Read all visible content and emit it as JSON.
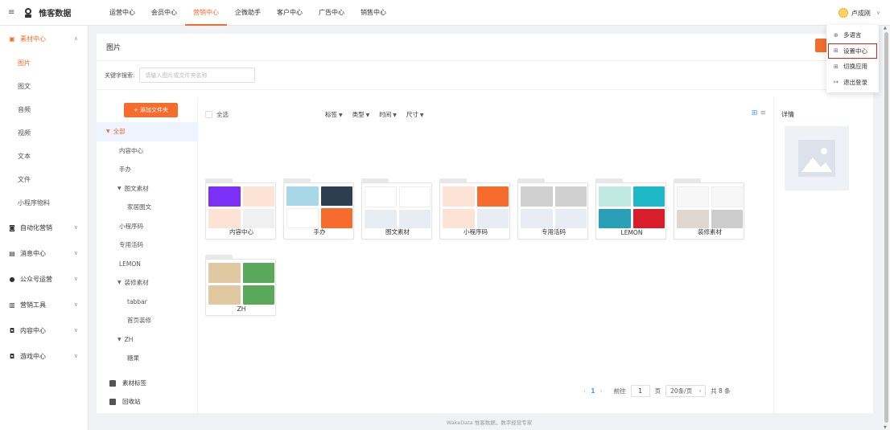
{
  "topbar": {
    "brand": "惟客数据",
    "nav": [
      "运营中心",
      "会员中心",
      "营销中心",
      "企微助手",
      "客户中心",
      "广告中心",
      "销售中心"
    ],
    "active_nav_index": 2,
    "user_name": "卢成刚"
  },
  "sidebar": {
    "items": [
      {
        "label": "素材中心",
        "icon": "image-icon",
        "open": true,
        "children": [
          "图片",
          "图文",
          "音频",
          "视频",
          "文本",
          "文件",
          "小程序物料"
        ]
      },
      {
        "label": "自动化营销",
        "icon": "robot-icon"
      },
      {
        "label": "消息中心",
        "icon": "message-icon"
      },
      {
        "label": "公众号运营",
        "icon": "chat-icon"
      },
      {
        "label": "营销工具",
        "icon": "bar-chart-icon"
      },
      {
        "label": "内容中心",
        "icon": "gamepad-icon"
      },
      {
        "label": "游戏中心",
        "icon": "gamepad-icon"
      }
    ],
    "active_child_index": 0
  },
  "page": {
    "title": "图片",
    "search_label": "关键字搜索:",
    "search_placeholder": "请输入图片或文件夹名称"
  },
  "tree": {
    "add_folder": "+ 添加文件夹",
    "nodes": [
      {
        "label": "全部",
        "level": 0,
        "arrow": true,
        "selected": true
      },
      {
        "label": "内容中心",
        "level": 1
      },
      {
        "label": "手办",
        "level": 1
      },
      {
        "label": "图文素材",
        "level": 1,
        "arrow": true
      },
      {
        "label": "家居图文",
        "level": 2
      },
      {
        "label": "小程序码",
        "level": 1
      },
      {
        "label": "专用活码",
        "level": 1
      },
      {
        "label": "LEMON",
        "level": 1
      },
      {
        "label": "装修素材",
        "level": 1,
        "arrow": true
      },
      {
        "label": "tabbar",
        "level": 2
      },
      {
        "label": "首页装修",
        "level": 2
      },
      {
        "label": "ZH",
        "level": 1,
        "arrow": true
      },
      {
        "label": "糖果",
        "level": 2
      }
    ],
    "bottom": [
      "素材标签",
      "回收站"
    ]
  },
  "toolbar": {
    "select_all": "全选",
    "filters": [
      "标签",
      "类型",
      "时间",
      "尺寸"
    ]
  },
  "folders": [
    {
      "name": "内容中心",
      "thumbs": [
        "#7b2ff7",
        "#fde3d6",
        "#fde3d6",
        "#f0f0f0"
      ]
    },
    {
      "name": "手办",
      "thumbs": [
        "#a8d8e8",
        "#2c3e50",
        "#ffffff",
        "#f56c2d"
      ]
    },
    {
      "name": "图文素材",
      "thumbs": [
        "#ffffff",
        "#ffffff",
        "#e8ecf3",
        "#e8ecf3"
      ]
    },
    {
      "name": "小程序码",
      "thumbs": [
        "#fde3d6",
        "#f56c2d",
        "#fde3d6",
        "#e8ecf3"
      ]
    },
    {
      "name": "专用活码",
      "thumbs": [
        "#d0d0d0",
        "#d0d0d0",
        "#e8ecf3",
        "#e8ecf3"
      ]
    },
    {
      "name": "LEMON",
      "thumbs": [
        "#bfe8e0",
        "#1fb8c8",
        "#2a9fb8",
        "#d81e2a"
      ]
    },
    {
      "name": "装修素材",
      "thumbs": [
        "#f7f7f7",
        "#f7f7f7",
        "#e0d8d0",
        "#cccccc"
      ]
    },
    {
      "name": "ZH",
      "thumbs": [
        "#e0c8a0",
        "#5aa85a",
        "#e0c8a0",
        "#5aa85a"
      ]
    }
  ],
  "detail": {
    "title": "详情"
  },
  "pagination": {
    "current": "1",
    "goto_label": "前往",
    "goto_value": "1",
    "page_unit": "页",
    "page_size": "20条/页",
    "total": "共 8 条"
  },
  "footer": "WakeData 惟客数据，数字经营专家",
  "dropdown": {
    "items": [
      {
        "label": "多语言",
        "icon": "language-icon"
      },
      {
        "label": "设置中心",
        "icon": "settings-icon",
        "highlight": true
      },
      {
        "label": "切换应用",
        "icon": "apps-icon"
      },
      {
        "label": "退出登录",
        "icon": "logout-icon"
      }
    ]
  }
}
